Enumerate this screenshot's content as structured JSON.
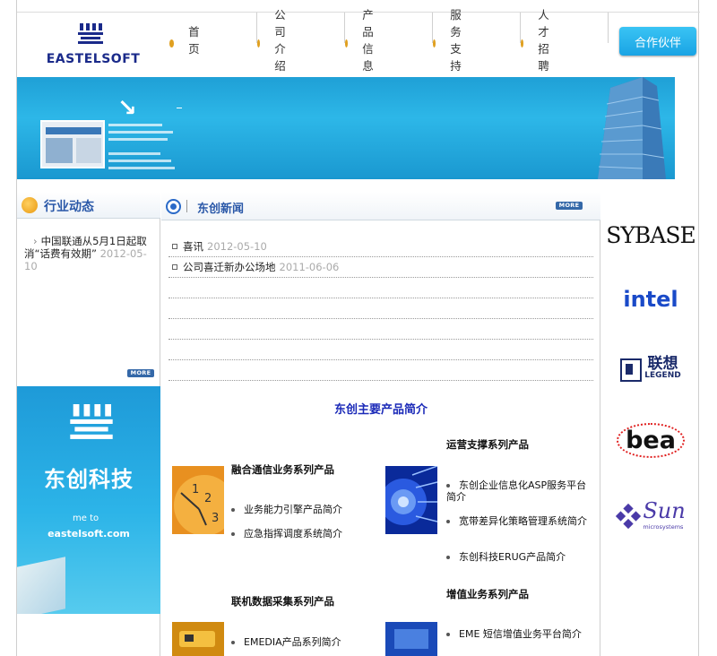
{
  "header": {
    "logo_text": "EASTELSOFT",
    "nav": [
      "首 页",
      "公司介绍",
      "产品信息",
      "服务支持",
      "人才招聘"
    ],
    "partner_label": "合作伙伴"
  },
  "banner": {
    "icon": "arrow-down-right-icon"
  },
  "left": {
    "section_title": "行业动态",
    "news": [
      {
        "title": "中国联通从5月1日起取消“话费有效期”",
        "date": "2012-05-10"
      }
    ],
    "more": "MORE",
    "ad": {
      "title": "东创科技",
      "welcome": "me to",
      "site": "eastelsoft.com"
    }
  },
  "middle": {
    "section_title": "东创新闻",
    "more": "MORE",
    "news": [
      {
        "title": "喜讯",
        "date": "2012-05-10"
      },
      {
        "title": "公司喜迁新办公场地",
        "date": "2011-06-06"
      },
      {
        "title": "",
        "date": ""
      },
      {
        "title": "",
        "date": ""
      },
      {
        "title": "",
        "date": ""
      },
      {
        "title": "",
        "date": ""
      },
      {
        "title": "",
        "date": ""
      }
    ],
    "products_title": "东创主要产品简介",
    "products": [
      {
        "heading": "融合通信业务系列产品",
        "items": [
          "业务能力引擎产品简介",
          "应急指挥调度系统简介"
        ]
      },
      {
        "heading": "运营支撑系列产品",
        "items": [
          "东创企业信息化ASP服务平台简介",
          "宽带差异化策略管理系统简介",
          "东创科技ERUG产品简介"
        ]
      },
      {
        "heading": "联机数据采集系列产品",
        "items": [
          "EMEDIA产品系列简介"
        ]
      },
      {
        "heading": "增值业务系列产品",
        "items": [
          "EME 短信增值业务平台简介"
        ]
      }
    ]
  },
  "partners": [
    "SYBASE",
    "intel",
    "联想",
    "LEGEND",
    "bea",
    "Sun",
    "microsystems"
  ],
  "colors": {
    "brand_blue": "#1a2a8a",
    "banner_blue": "#1fa0d6",
    "link_blue": "#1b2ab8",
    "partner_button": "#29b4ec"
  }
}
